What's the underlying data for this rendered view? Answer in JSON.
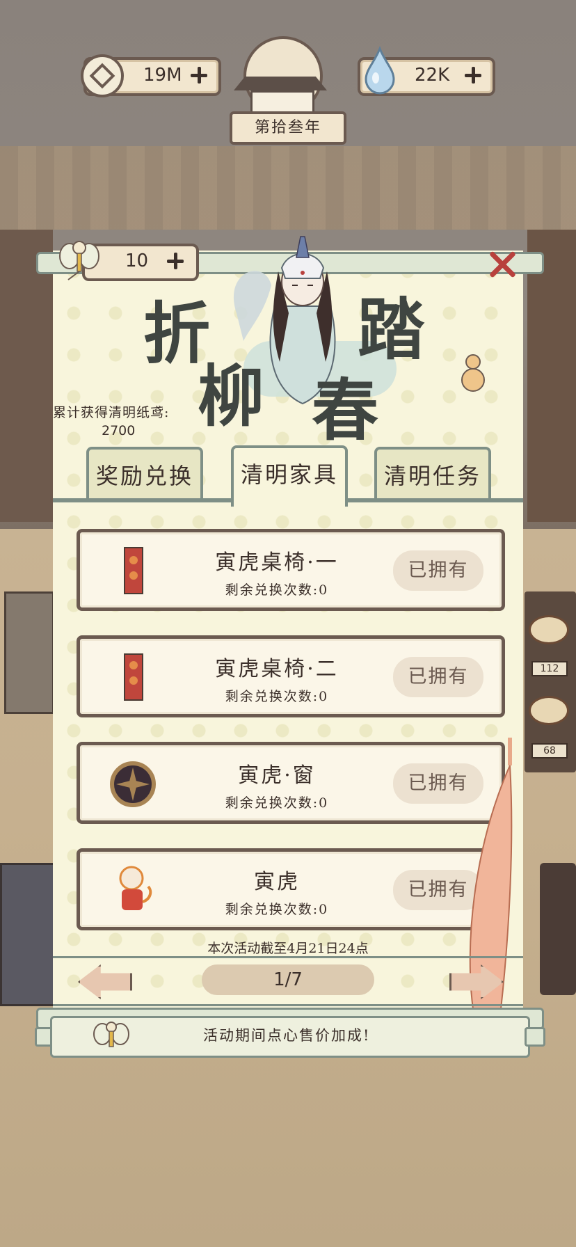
{
  "hud": {
    "coins": "19M",
    "water": "22K",
    "year": "第拾叁年"
  },
  "event": {
    "kite_count": "10",
    "title_chars": [
      "折",
      "柳",
      "踏",
      "春"
    ],
    "total_label": "累计获得清明纸鸢:",
    "total_value": "2700"
  },
  "tabs": [
    {
      "label": "奖励兑换",
      "active": false
    },
    {
      "label": "清明家具",
      "active": true
    },
    {
      "label": "清明任务",
      "active": false
    }
  ],
  "items": [
    {
      "name": "寅虎桌椅·一",
      "remaining": "剩余兑换次数:0",
      "button": "已拥有",
      "icon": "tiger-table-chair-icon"
    },
    {
      "name": "寅虎桌椅·二",
      "remaining": "剩余兑换次数:0",
      "button": "已拥有",
      "icon": "tiger-table-chair-icon"
    },
    {
      "name": "寅虎·窗",
      "remaining": "剩余兑换次数:0",
      "button": "已拥有",
      "icon": "round-window-icon"
    },
    {
      "name": "寅虎",
      "remaining": "剩余兑换次数:0",
      "button": "已拥有",
      "icon": "tiger-character-icon"
    }
  ],
  "deadline": "本次活动截至4月21日24点",
  "pagination": {
    "current": 1,
    "total": 7,
    "label": "1/7"
  },
  "notice": "活动期间点心售价加成!",
  "side_counts": [
    "112",
    "68"
  ],
  "colors": {
    "frame": "#6b5a50",
    "panel": "#f8f5dc",
    "accent_green": "#7e8f86",
    "close_red": "#b8413d"
  }
}
